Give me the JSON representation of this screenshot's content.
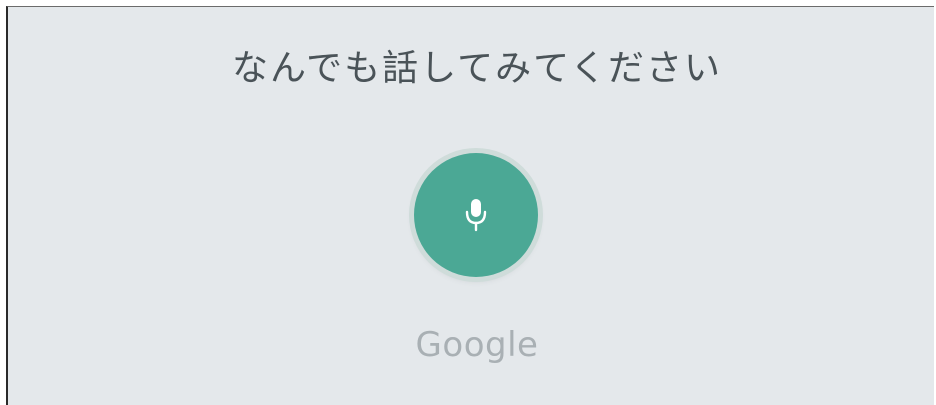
{
  "prompt": {
    "text": "なんでも話してみてください"
  },
  "mic": {
    "icon": "microphone-icon",
    "color": "#4ba895"
  },
  "brand": {
    "text": "Google"
  },
  "colors": {
    "background": "#e4e8eb",
    "accent": "#4ba895",
    "prompt_text": "#4a5358",
    "brand_text": "#a9b0b4"
  }
}
